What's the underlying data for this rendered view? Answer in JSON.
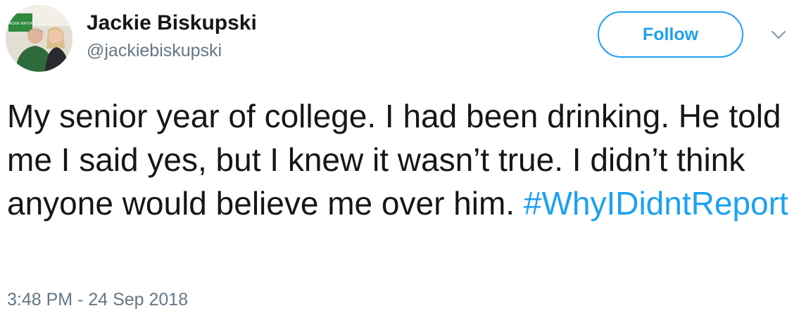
{
  "user": {
    "display_name": "Jackie Biskupski",
    "handle": "@jackiebiskupski",
    "avatar_sign_text": "JACKIE MAYOR"
  },
  "follow_button": {
    "label": "Follow"
  },
  "tweet": {
    "text": "My senior year of college. I had been drinking. He told me I said yes, but I knew it wasn’t true. I didn’t think anyone would believe me over him.",
    "hashtag": "#WhyIDidntReport",
    "timestamp": "3:48 PM - 24 Sep 2018"
  },
  "icons": {
    "menu": "chevron-down-icon",
    "avatar": "profile-photo"
  },
  "colors": {
    "accent": "#1da1f2",
    "text": "#14171a",
    "secondary_text": "#657786"
  }
}
